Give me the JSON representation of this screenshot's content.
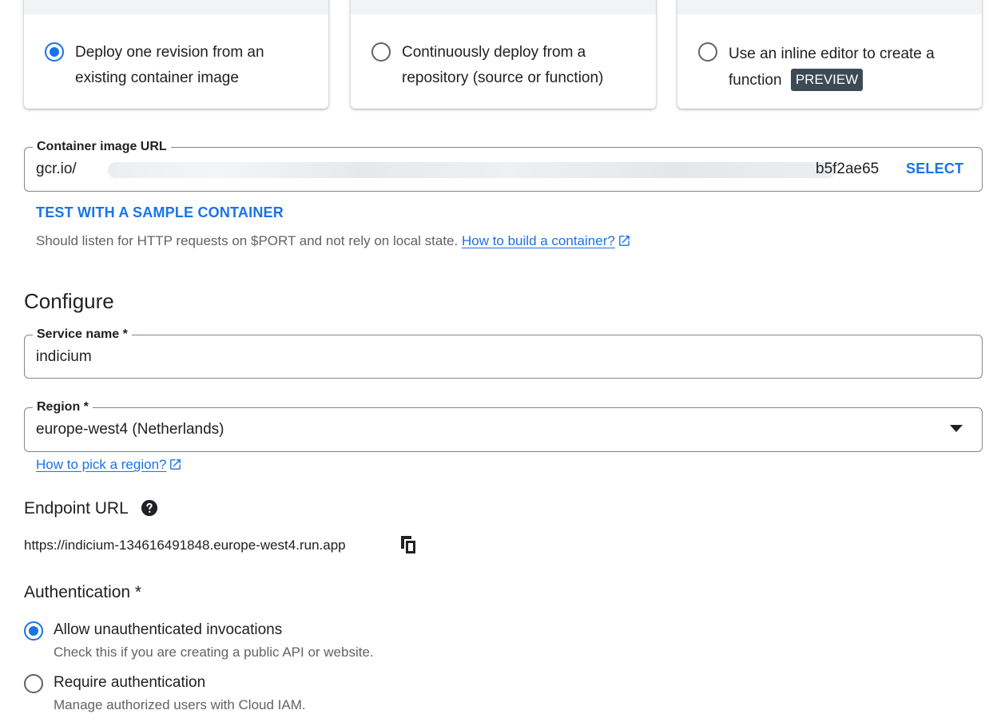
{
  "deploy_options": [
    {
      "label": "Deploy one revision from an existing container image",
      "selected": true
    },
    {
      "label": "Continuously deploy from a repository (source or function)",
      "selected": false
    },
    {
      "label": "Use an inline editor to create a function",
      "badge": "PREVIEW",
      "selected": false
    }
  ],
  "container": {
    "label": "Container image URL",
    "value_prefix": "gcr.io/",
    "value_suffix": "b5f2ae65",
    "select_label": "SELECT",
    "test_sample_label": "TEST WITH A SAMPLE CONTAINER",
    "hint": "Should listen for HTTP requests on $PORT and not rely on local state.",
    "hint_link": "How to build a container?"
  },
  "configure": {
    "title": "Configure",
    "service_name": {
      "label": "Service name *",
      "value": "indicium"
    },
    "region": {
      "label": "Region *",
      "value": "europe-west4 (Netherlands)",
      "help_link": "How to pick a region?"
    }
  },
  "endpoint": {
    "title": "Endpoint URL",
    "url": "https://indicium-134616491848.europe-west4.run.app"
  },
  "authentication": {
    "title": "Authentication *",
    "options": [
      {
        "label": "Allow unauthenticated invocations",
        "description": "Check this if you are creating a public API or website.",
        "selected": true
      },
      {
        "label": "Require authentication",
        "description": "Manage authorized users with Cloud IAM.",
        "selected": false
      }
    ]
  },
  "colors": {
    "accent": "#1a73e8",
    "badge_bg": "#3c4a55",
    "text": "#202124",
    "secondary_text": "#5f6368"
  }
}
